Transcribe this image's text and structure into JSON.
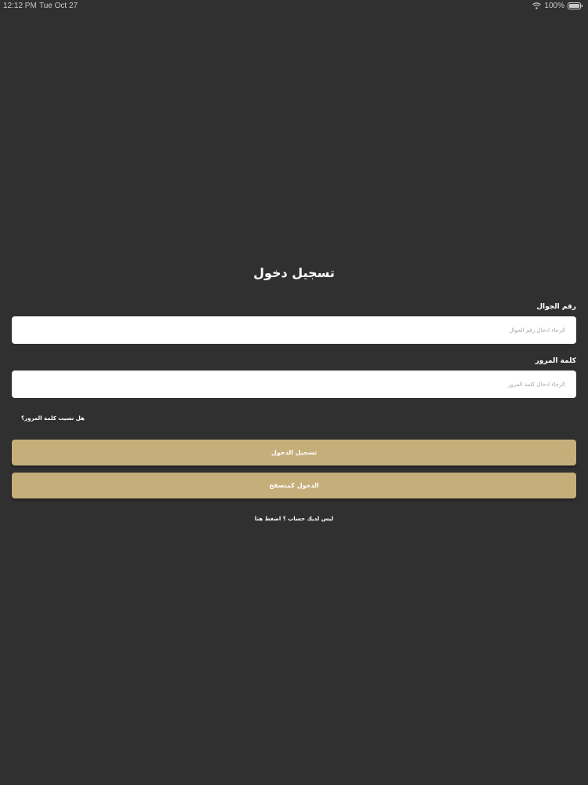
{
  "status_bar": {
    "time": "12:12 PM",
    "date": "Tue Oct 27",
    "battery": "100%"
  },
  "login": {
    "title": "تسجيل دخول",
    "phone_label": "رقم الجوال",
    "phone_placeholder": "الرجاء ادخال رقم الجوال",
    "phone_value": "",
    "password_label": "كلمة المرور",
    "password_placeholder": "الرجاء ادخال كلمة المرور",
    "password_value": "",
    "forgot_password": "هل نسيت كلمة المرور؟",
    "login_button": "تسجيل الدخول",
    "guest_button": "الدخول كمتصفح",
    "signup_link": "ليس لديك حساب ؟ اضغط هنا"
  },
  "colors": {
    "background": "#313031",
    "button": "#c5ae7a",
    "input": "#ffffff"
  }
}
